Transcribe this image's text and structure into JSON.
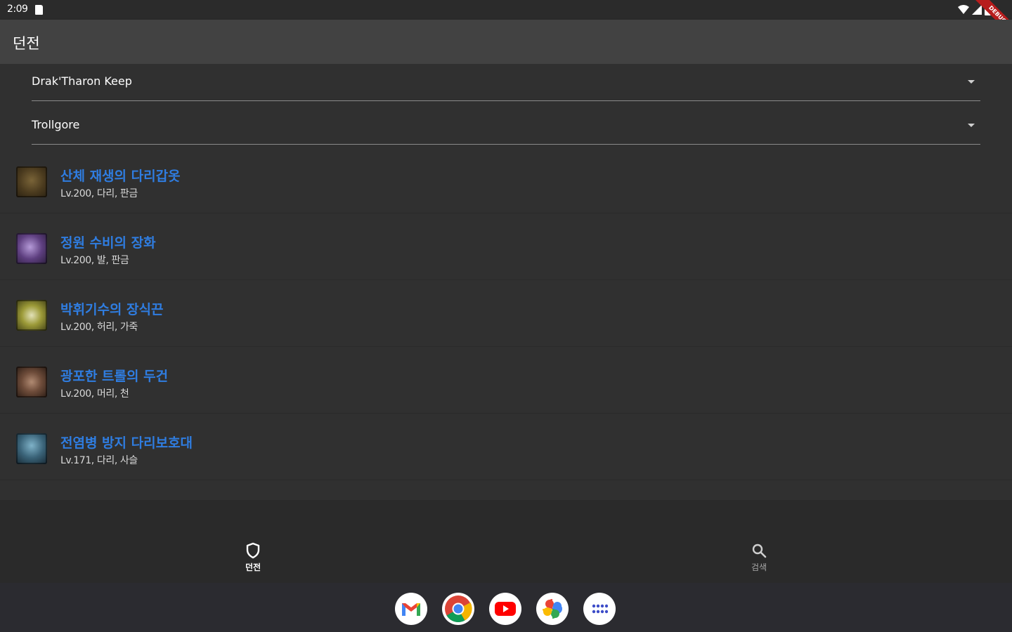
{
  "status_bar": {
    "time": "2:09",
    "banner": "DEBUG"
  },
  "app_bar": {
    "title": "던전"
  },
  "filters": {
    "dungeon": "Drak'Tharon Keep",
    "boss": "Trollgore"
  },
  "items": [
    {
      "name": "산체 재생의 다리갑옷",
      "meta": "Lv.200, 다리, 판금",
      "icon": "leg-armor-icon",
      "color": "#6b5530"
    },
    {
      "name": "정원 수비의 장화",
      "meta": "Lv.200, 발, 판금",
      "icon": "boots-icon",
      "color": "#6a4f86"
    },
    {
      "name": "박휘기수의 장식끈",
      "meta": "Lv.200, 허리, 가죽",
      "icon": "belt-icon",
      "color": "#a5a23a"
    },
    {
      "name": "광포한 트롤의 두건",
      "meta": "Lv.200, 머리, 천",
      "icon": "hood-icon",
      "color": "#7a5a48"
    },
    {
      "name": "전염병 방지 다리보호대",
      "meta": "Lv.171, 다리, 사슬",
      "icon": "leg-guard-icon",
      "color": "#4a7890"
    },
    {
      "name": "",
      "meta": "",
      "icon": "partial-item-icon",
      "color": "#3a3a3a"
    }
  ],
  "bottom_nav": {
    "dungeon_label": "던전",
    "search_label": "검색"
  },
  "dock": [
    "gmail-icon",
    "chrome-icon",
    "youtube-icon",
    "photos-icon",
    "app-drawer-icon"
  ],
  "colors": {
    "background": "#303030",
    "app_bar": "#424242",
    "item_link": "#2f7de1",
    "bottom_nav": "#2a2a2a",
    "taskbar": "#2b2b30"
  }
}
